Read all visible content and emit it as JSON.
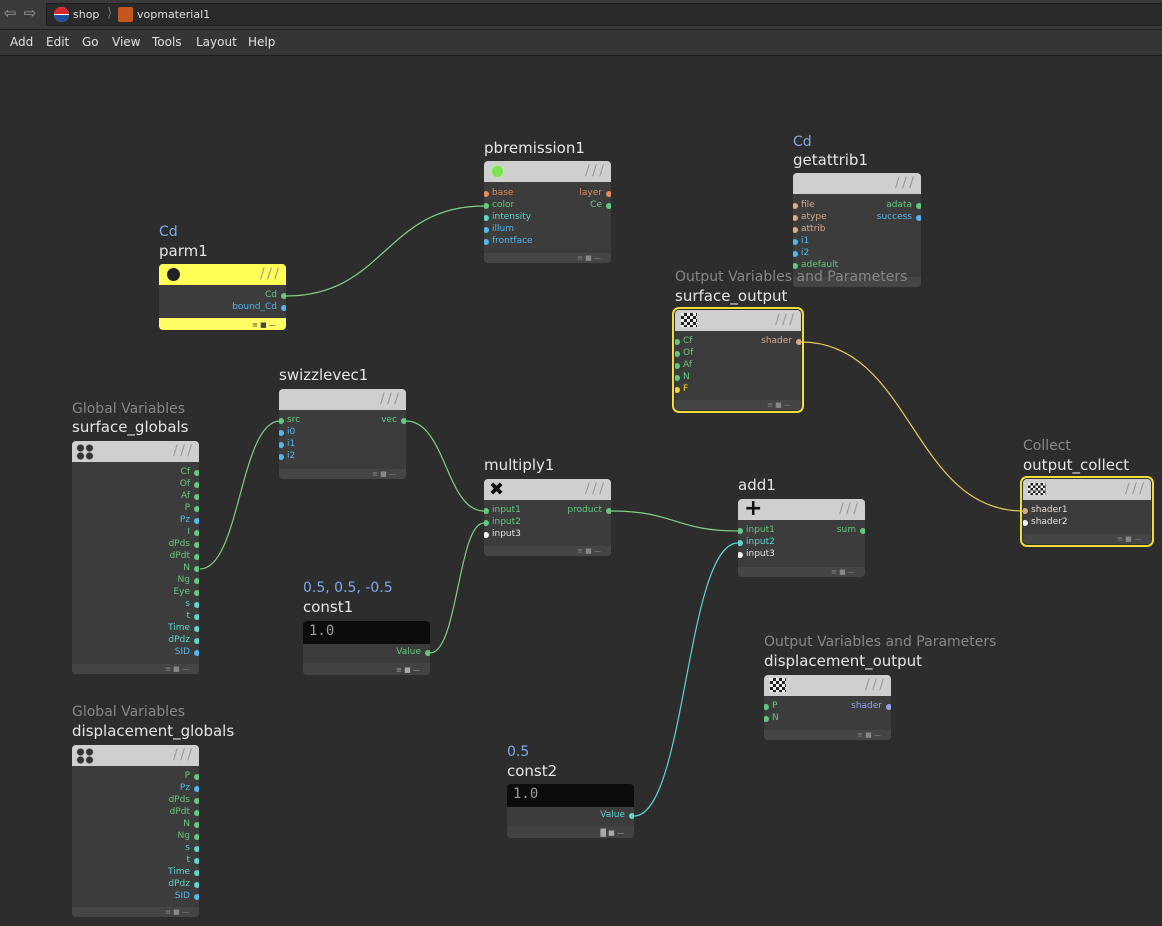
{
  "breadcrumb": {
    "items": [
      {
        "label": "shop"
      },
      {
        "label": "vopmaterial1"
      }
    ]
  },
  "menu": {
    "items": [
      "Add",
      "Edit",
      "Go",
      "View",
      "Tools",
      "Layout",
      "Help"
    ]
  },
  "colors": {
    "accent_selected": "#f2dd3a",
    "wire_green": "#7fcf85",
    "wire_yellow": "#e2c95a",
    "wire_teal": "#5ed6cc"
  },
  "nodes": {
    "pbremission1": {
      "name": "pbremission1",
      "inputs": [
        "base",
        "color",
        "intensity",
        "illum",
        "frontface"
      ],
      "outputs": [
        "layer",
        "Ce"
      ]
    },
    "getattrib1": {
      "sub": "Cd",
      "name": "getattrib1",
      "inputs": [
        "file",
        "atype",
        "attrib",
        "i1",
        "i2",
        "adefault"
      ],
      "outputs": [
        "adata",
        "success"
      ]
    },
    "parm1": {
      "sub": "Cd",
      "name": "parm1",
      "outputs": [
        "Cd",
        "bound_Cd"
      ]
    },
    "surface_output": {
      "sub": "Output Variables and Parameters",
      "name": "surface_output",
      "inputs": [
        "Cf",
        "Of",
        "Af",
        "N",
        "F"
      ],
      "outputs": [
        "shader"
      ]
    },
    "swizzlevec1": {
      "name": "swizzlevec1",
      "inputs": [
        "src",
        "i0",
        "i1",
        "i2"
      ],
      "outputs": [
        "vec"
      ]
    },
    "surface_globals": {
      "sub": "Global Variables",
      "name": "surface_globals",
      "outputs": [
        "Cf",
        "Of",
        "Af",
        "P",
        "Pz",
        "I",
        "dPds",
        "dPdt",
        "N",
        "Ng",
        "Eye",
        "s",
        "t",
        "Time",
        "dPdz",
        "SID"
      ]
    },
    "multiply1": {
      "name": "multiply1",
      "inputs": [
        "input1",
        "input2",
        "input3"
      ],
      "outputs": [
        "product"
      ]
    },
    "add1": {
      "name": "add1",
      "inputs": [
        "input1",
        "input2",
        "input3"
      ],
      "outputs": [
        "sum"
      ]
    },
    "output_collect": {
      "sub": "Collect",
      "name": "output_collect",
      "inputs": [
        "shader1",
        "shader2"
      ]
    },
    "const1": {
      "sub": "0.5, 0.5, -0.5",
      "name": "const1",
      "icon_text": "1.0",
      "outputs": [
        "Value"
      ]
    },
    "displacement_output": {
      "sub": "Output Variables and Parameters",
      "name": "displacement_output",
      "inputs": [
        "P",
        "N"
      ],
      "outputs": [
        "shader"
      ]
    },
    "displacement_globals": {
      "sub": "Global Variables",
      "name": "displacement_globals",
      "outputs": [
        "P",
        "Pz",
        "dPds",
        "dPdt",
        "N",
        "Ng",
        "s",
        "t",
        "Time",
        "dPdz",
        "SID"
      ]
    },
    "const2": {
      "sub": "0.5",
      "name": "const2",
      "icon_text": "1.0",
      "outputs": [
        "Value"
      ]
    }
  }
}
